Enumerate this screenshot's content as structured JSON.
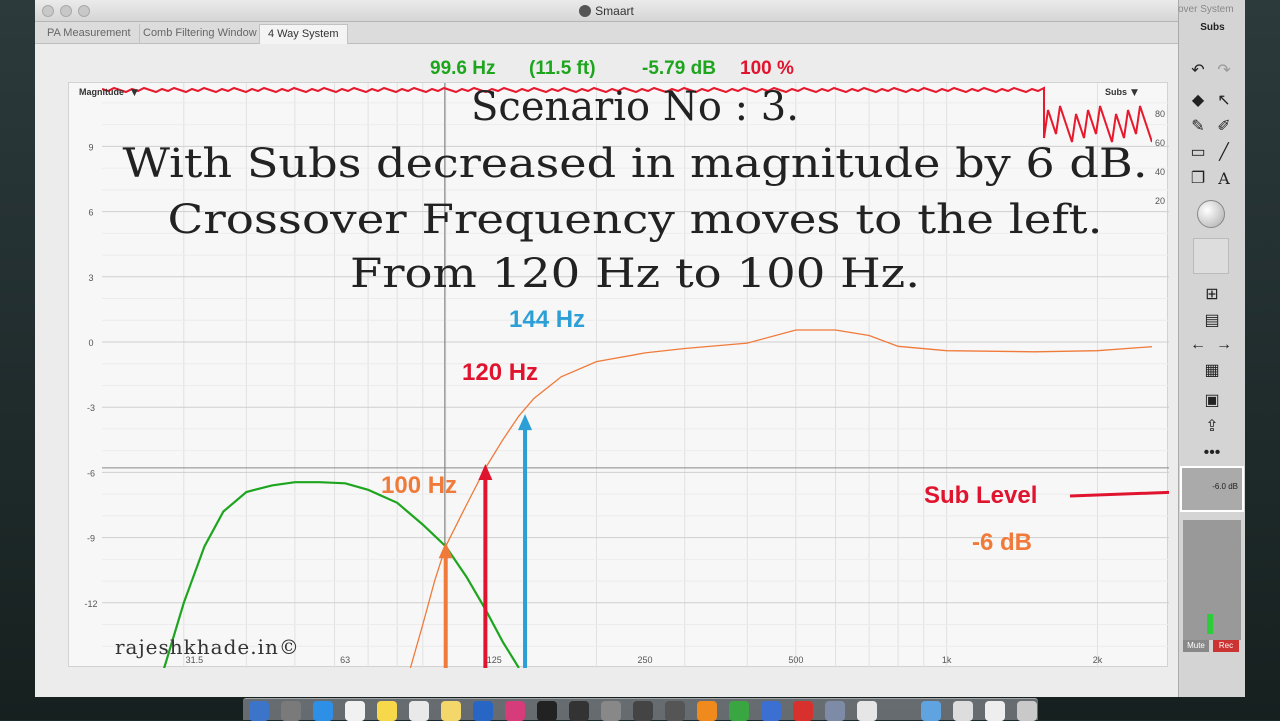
{
  "window": {
    "title": "Smaart",
    "bg_title_fragment": "over System",
    "tabs": [
      {
        "label": "PA Measurement"
      },
      {
        "label": "Comb Filtering Window"
      },
      {
        "label": "4 Way System"
      }
    ]
  },
  "readout": {
    "frequency": "99.6 Hz",
    "distance": "(11.5 ft)",
    "magnitude": "-5.79 dB",
    "percent": "100 %"
  },
  "plot": {
    "magnitude_label": "Magnitude",
    "subs_label": "Subs",
    "right_axis_ticks": [
      "80",
      "60",
      "40",
      "20"
    ],
    "annotations": {
      "line1": "Scenario No : 3.",
      "line2": "With Subs decreased in magnitude by 6 dB.",
      "line3": "Crossover Frequency moves to the left.",
      "line4": "From 120 Hz to 100 Hz.",
      "label_144": "144 Hz",
      "label_120": "120 Hz",
      "label_100": "100 Hz",
      "sub_level": "Sub Level",
      "sub_level_value": "-6 dB",
      "watermark": "rajeshkhade.in©"
    },
    "colors": {
      "green": "#1ea51e",
      "orange": "#f07a3a",
      "red": "#e0142e",
      "blue": "#2b9fd6",
      "trace_red": "#e8192c"
    }
  },
  "chart_data": {
    "type": "line",
    "xscale": "log",
    "xlim": [
      20,
      3000
    ],
    "ylim": [
      -14,
      11
    ],
    "x_ticks": [
      31.5,
      63,
      125,
      250,
      500,
      1000,
      2000
    ],
    "x_tick_labels": [
      "31.5",
      "63",
      "125",
      "250",
      "500",
      "1k",
      "2k"
    ],
    "y_ticks": [
      9,
      6,
      3,
      0,
      -3,
      -6,
      -9,
      -12
    ],
    "y_tick_labels": [
      "9",
      "6",
      "3",
      "0",
      "-3",
      "-6",
      "-9",
      "-12"
    ],
    "cursor_x": 99.6,
    "hline_y": -5.79,
    "series": [
      {
        "color": "#1ea51e",
        "x": [
          27,
          30,
          33,
          36,
          40,
          45,
          50,
          56,
          63,
          70,
          80,
          90,
          100,
          110,
          120,
          130,
          140
        ],
        "y": [
          -15.5,
          -12,
          -9.4,
          -7.8,
          -6.9,
          -6.6,
          -6.45,
          -6.45,
          -6.5,
          -6.8,
          -7.4,
          -8.4,
          -9.4,
          -10.8,
          -12.3,
          -13.8,
          -15
        ]
      },
      {
        "color": "#f07a3a",
        "x": [
          85,
          90,
          95,
          100,
          110,
          120,
          130,
          140,
          150,
          170,
          200,
          250,
          300,
          400,
          500,
          600,
          700,
          800,
          1000,
          1500,
          2000,
          3000
        ],
        "y": [
          -15,
          -13,
          -11,
          -9.4,
          -7.5,
          -5.8,
          -4.5,
          -3.4,
          -2.6,
          -1.6,
          -0.9,
          -0.5,
          -0.3,
          -0.05,
          0.55,
          0.55,
          0.3,
          -0.2,
          -0.4,
          -0.45,
          -0.4,
          -0.1
        ]
      }
    ],
    "markers": [
      {
        "label": "100 Hz",
        "x": 100,
        "y": -9.4,
        "color": "#f07a3a"
      },
      {
        "label": "120 Hz",
        "x": 120,
        "y": -5.8,
        "color": "#e0142e"
      },
      {
        "label": "144 Hz",
        "x": 144,
        "y": -3.5,
        "color": "#2b9fd6"
      }
    ]
  },
  "right_panel": {
    "header": "Subs",
    "meter_value": "-6.0 dB",
    "mute_label": "Mute",
    "rec_label": "Rec"
  }
}
